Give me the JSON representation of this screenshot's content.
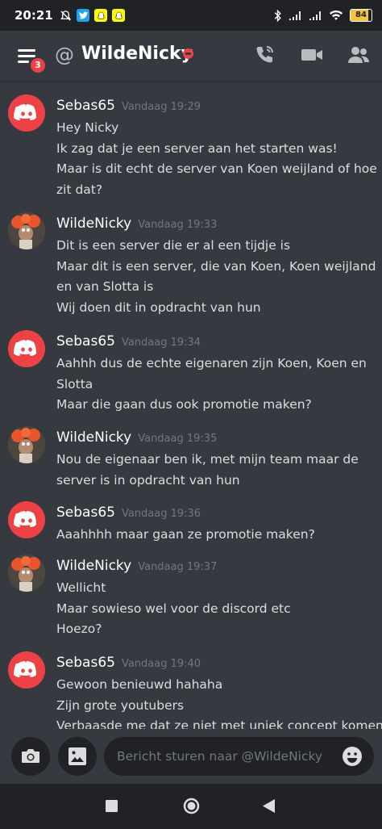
{
  "status_bar": {
    "time": "20:21",
    "battery": "84"
  },
  "header": {
    "at_symbol": "@",
    "title": "WildeNicky",
    "menu_badge": "3"
  },
  "messages": [
    {
      "author": "Sebas65",
      "avatar": "discord",
      "timestamp": "Vandaag 19:29",
      "lines": [
        "Hey Nicky",
        "Ik zag dat je een server aan het starten was!",
        "Maar is dit echt de server van Koen weijland of hoe",
        "zit dat?"
      ]
    },
    {
      "author": "WildeNicky",
      "avatar": "photo",
      "timestamp": "Vandaag 19:33",
      "lines": [
        "Dit is een server die er al een tijdje is",
        "Maar dit is een server, die van Koen, Koen weijland",
        "en van Slotta is",
        "Wij doen dit in opdracht van hun"
      ]
    },
    {
      "author": "Sebas65",
      "avatar": "discord",
      "timestamp": "Vandaag 19:34",
      "lines": [
        "Aahhh dus de echte eigenaren zijn Koen, Koen en",
        "Slotta",
        "Maar die gaan dus ook promotie maken?"
      ]
    },
    {
      "author": "WildeNicky",
      "avatar": "photo",
      "timestamp": "Vandaag 19:35",
      "lines": [
        "Nou de eigenaar ben ik, met mijn team maar de",
        "server is in opdracht van hun"
      ]
    },
    {
      "author": "Sebas65",
      "avatar": "discord",
      "timestamp": "Vandaag 19:36",
      "lines": [
        "Aaahhhh maar gaan ze promotie maken?"
      ]
    },
    {
      "author": "WildeNicky",
      "avatar": "photo",
      "timestamp": "Vandaag 19:37",
      "lines": [
        "Wellicht",
        "Maar sowieso wel voor de discord etc",
        "Hoezo?"
      ]
    },
    {
      "author": "Sebas65",
      "avatar": "discord",
      "timestamp": "Vandaag 19:40",
      "lines": [
        "Gewoon benieuwd hahaha",
        "Zijn grote youtubers",
        "Verbaasde me dat ze niet met uniek concept komen"
      ]
    }
  ],
  "composer": {
    "placeholder": "Bericht sturen naar @WildeNicky"
  },
  "colors": {
    "background": "#36393f",
    "dark": "#202225",
    "discord_red": "#ed4245",
    "timestamp": "#72767d"
  }
}
